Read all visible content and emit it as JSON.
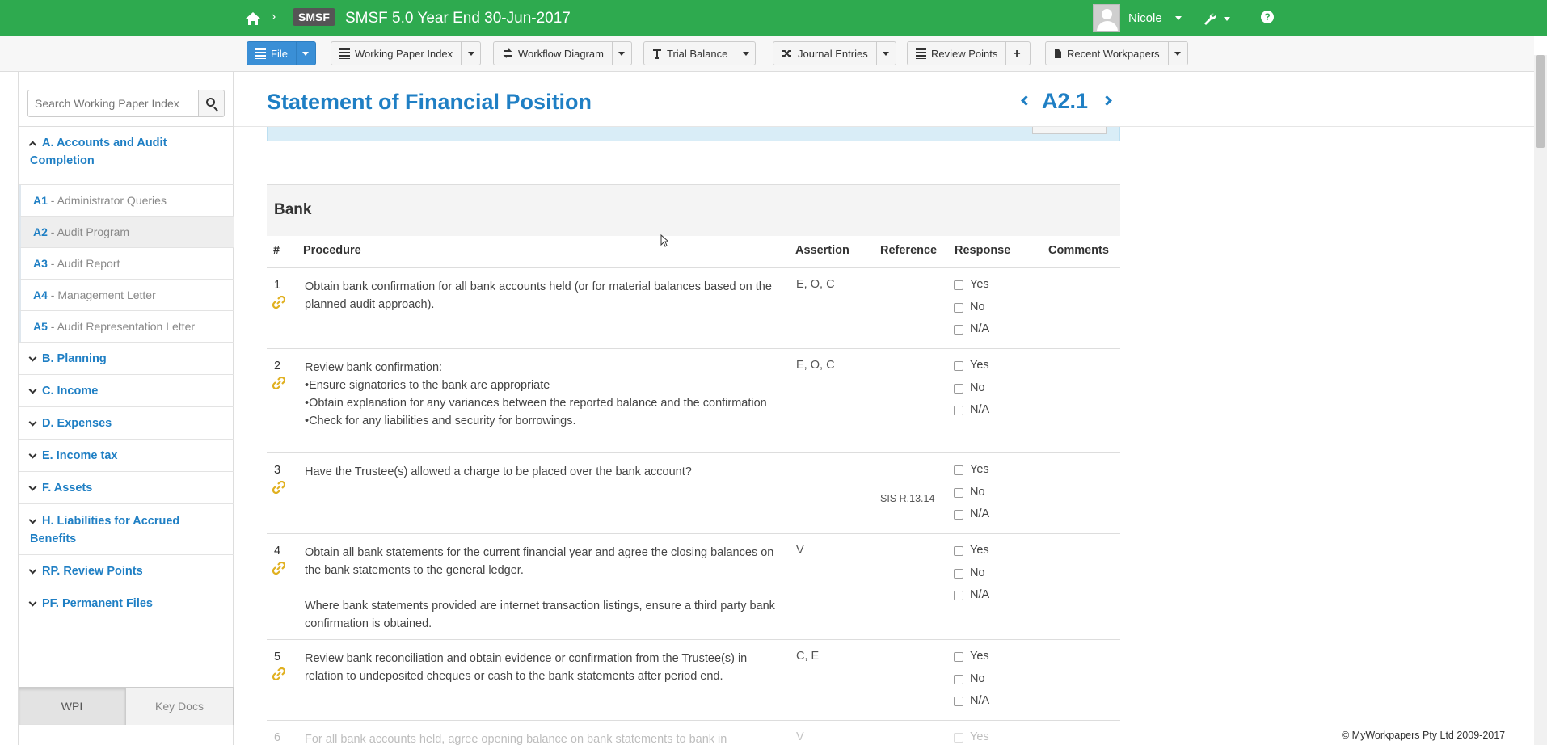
{
  "topbar": {
    "badge": "SMSF",
    "title": "SMSF 5.0  Year End 30-Jun-2017",
    "user_name": "Nicole",
    "help": "?"
  },
  "toolbar": {
    "file": "File",
    "working_paper_index": "Working Paper Index",
    "workflow_diagram": "Workflow Diagram",
    "trial_balance": "Trial Balance",
    "journal_entries": "Journal Entries",
    "review_points": "Review Points",
    "recent_workpapers": "Recent Workpapers"
  },
  "sidebar": {
    "search_placeholder": "Search Working Paper Index",
    "sections": [
      {
        "label": "A. Accounts and Audit Completion",
        "expanded": true
      },
      {
        "label": "B. Planning",
        "expanded": false
      },
      {
        "label": "C. Income",
        "expanded": false
      },
      {
        "label": "D. Expenses",
        "expanded": false
      },
      {
        "label": "E. Income tax",
        "expanded": false
      },
      {
        "label": "F. Assets",
        "expanded": false
      },
      {
        "label": "H. Liabilities for Accrued Benefits",
        "expanded": false
      },
      {
        "label": "RP. Review Points",
        "expanded": false
      },
      {
        "label": "PF. Permanent Files",
        "expanded": false
      }
    ],
    "items": [
      {
        "code": "A1",
        "label": " - Administrator Queries"
      },
      {
        "code": "A2",
        "label": " - Audit Program",
        "active": true
      },
      {
        "code": "A3",
        "label": " - Audit Report"
      },
      {
        "code": "A4",
        "label": " - Management Letter"
      },
      {
        "code": "A5",
        "label": " - Audit Representation Letter"
      }
    ],
    "tabs": [
      "WPI",
      "Key Docs"
    ]
  },
  "main": {
    "title": "Statement of Financial Position",
    "code": "A2.1",
    "section_title": "Bank",
    "columns": [
      "#",
      "Procedure",
      "Assertion",
      "Reference",
      "Response",
      "Comments"
    ],
    "response_options": [
      "Yes",
      "No",
      "N/A"
    ],
    "rows": [
      {
        "num": "1",
        "procedure": [
          "Obtain bank confirmation for all bank accounts held (or for material balances based on the planned audit approach)."
        ],
        "assertion": "E, O, C",
        "reference": ""
      },
      {
        "num": "2",
        "procedure": [
          "Review bank confirmation:",
          "•Ensure signatories to the bank are appropriate",
          "•Obtain explanation for any variances between the reported balance and the confirmation",
          "•Check for any liabilities and security for borrowings."
        ],
        "assertion": "E, O, C",
        "reference": ""
      },
      {
        "num": "3",
        "procedure": [
          "Have the Trustee(s) allowed a charge to be placed over the bank account?"
        ],
        "assertion": "",
        "reference": "SIS R.13.14"
      },
      {
        "num": "4",
        "procedure": [
          "Obtain all bank statements for the current financial year and agree the closing balances on the bank statements to the general ledger.",
          "",
          "Where bank statements provided are internet transaction listings, ensure a third party bank confirmation is obtained."
        ],
        "assertion": "V",
        "reference": ""
      },
      {
        "num": "5",
        "procedure": [
          "Review bank reconciliation and obtain evidence or confirmation from the Trustee(s) in relation to undeposited cheques or cash to the bank statements after period end."
        ],
        "assertion": "C, E",
        "reference": ""
      },
      {
        "num": "6",
        "procedure": [
          "For all bank accounts held, agree opening balance on bank statements to bank in"
        ],
        "assertion": "V",
        "reference": ""
      }
    ]
  },
  "footer": "© MyWorkpapers Pty Ltd 2009-2017",
  "colors": {
    "green": "#2eaa4f",
    "blue": "#1f7fc4",
    "link_icon": "#e0b020"
  }
}
